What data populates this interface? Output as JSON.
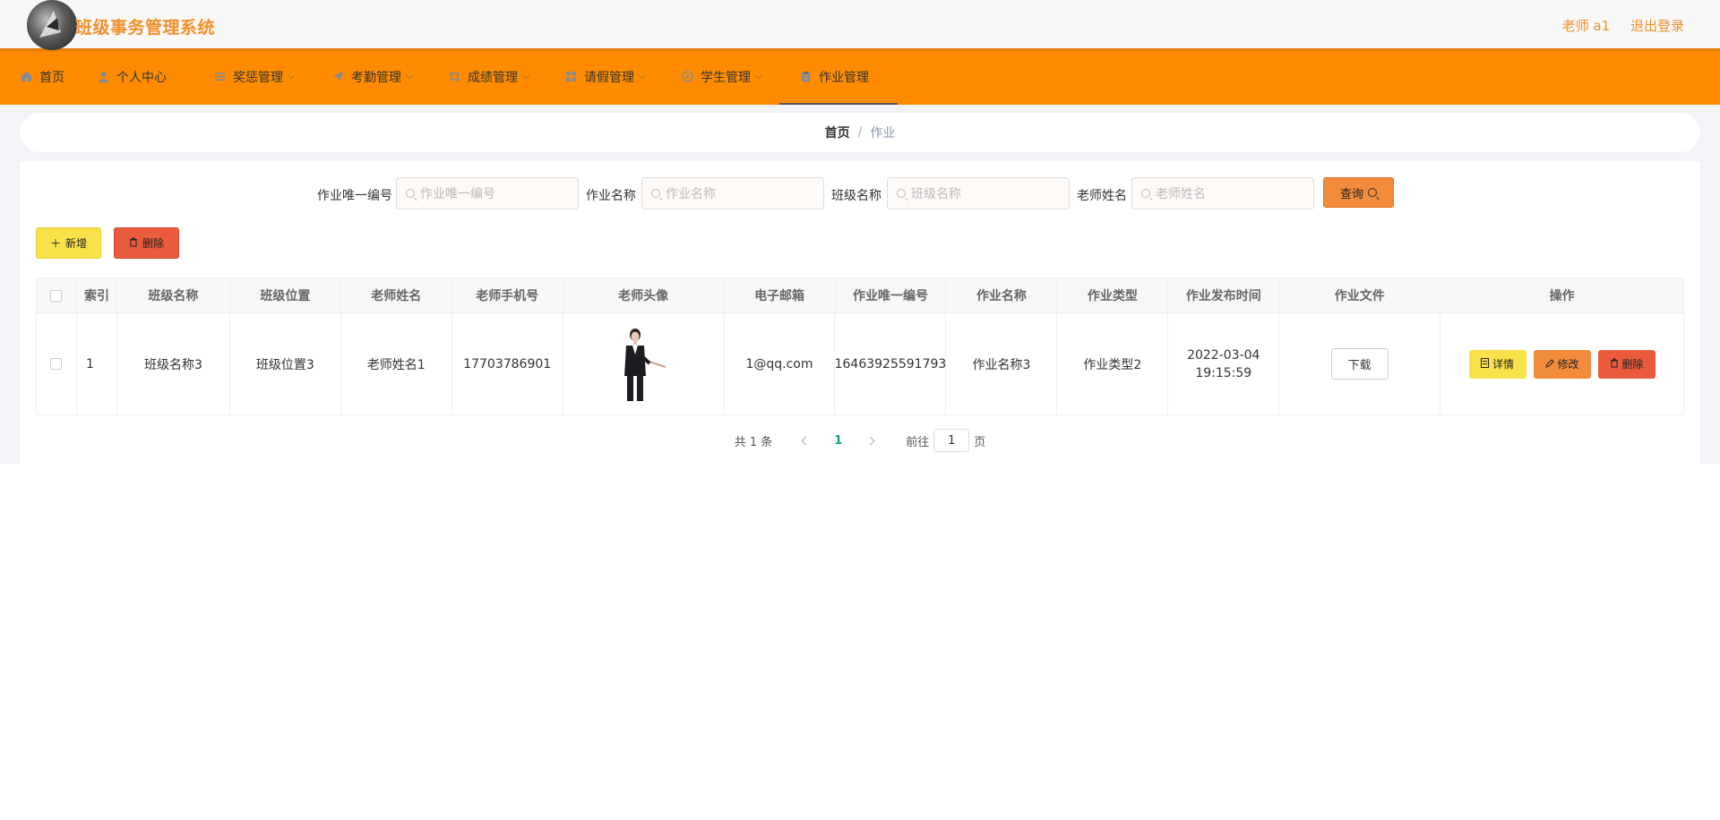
{
  "app": {
    "title": "班级事务管理系统"
  },
  "user": {
    "name": "老师 a1",
    "logout": "退出登录"
  },
  "nav": [
    {
      "label": "首页",
      "icon": "home-icon"
    },
    {
      "label": "个人中心",
      "icon": "user-icon"
    },
    {
      "label": "奖惩管理",
      "icon": "list-icon"
    },
    {
      "label": "考勤管理",
      "icon": "send-icon"
    },
    {
      "label": "成绩管理",
      "icon": "crop-icon"
    },
    {
      "label": "请假管理",
      "icon": "grid-icon"
    },
    {
      "label": "学生管理",
      "icon": "circle-icon"
    },
    {
      "label": "作业管理",
      "icon": "clipboard-icon"
    }
  ],
  "breadcrumb": {
    "home": "首页",
    "separator": "/",
    "current": "作业"
  },
  "search": {
    "fields": [
      {
        "label": "作业唯一编号",
        "placeholder": "作业唯一编号"
      },
      {
        "label": "作业名称",
        "placeholder": "作业名称"
      },
      {
        "label": "班级名称",
        "placeholder": "班级名称"
      },
      {
        "label": "老师姓名",
        "placeholder": "老师姓名"
      }
    ],
    "query_label": "查询"
  },
  "toolbar": {
    "add_label": "新增",
    "delete_label": "删除"
  },
  "table": {
    "headers": [
      "索引",
      "班级名称",
      "班级位置",
      "老师姓名",
      "老师手机号",
      "老师头像",
      "电子邮箱",
      "作业唯一编号",
      "作业名称",
      "作业类型",
      "作业发布时间",
      "作业文件",
      "操作"
    ],
    "rows": [
      {
        "index": "1",
        "class_name": "班级名称3",
        "class_location": "班级位置3",
        "teacher_name": "老师姓名1",
        "teacher_phone": "17703786901",
        "email": "1@qq.com",
        "homework_id": "16463925591793",
        "homework_name": "作业名称3",
        "homework_type": "作业类型2",
        "publish_time": "2022-03-04 19:15:59",
        "download_label": "下载",
        "detail_label": "详情",
        "edit_label": "修改",
        "delete_label": "删除"
      }
    ]
  },
  "pagination": {
    "total": "共 1 条",
    "current_page": "1",
    "goto_prefix": "前往",
    "goto_value": "1",
    "goto_suffix": "页"
  },
  "colors": {
    "brand": "#ff8c00",
    "title": "#f0902a",
    "yellow": "#f9e14a",
    "red": "#e95b3c",
    "orange": "#f28b3c"
  }
}
